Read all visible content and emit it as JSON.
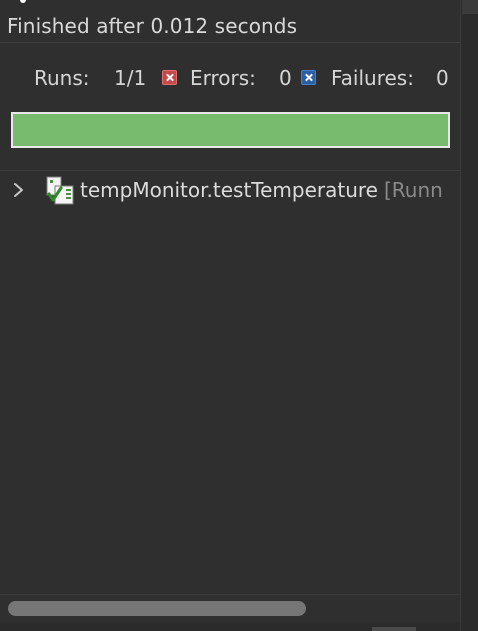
{
  "status": {
    "message": "Finished after 0.012 seconds"
  },
  "counters": {
    "runs_label": "Runs:",
    "runs_value": "1/1",
    "errors_label": "Errors:",
    "errors_value": "0",
    "failures_label": "Failures:",
    "failures_value": "0",
    "error_icon": "error-icon",
    "failure_icon": "failure-icon"
  },
  "progress": {
    "fraction": 1.0,
    "color": "#79bb6e"
  },
  "tree": {
    "items": [
      {
        "label": "tempMonitor.testTemperature",
        "suffix": "[Runn",
        "icon": "test-suite-passed-icon",
        "expanded": false
      }
    ]
  },
  "colors": {
    "background": "#2f2f2f",
    "success": "#79bb6e",
    "error": "#c24a4a",
    "failure": "#2a5fa8"
  }
}
